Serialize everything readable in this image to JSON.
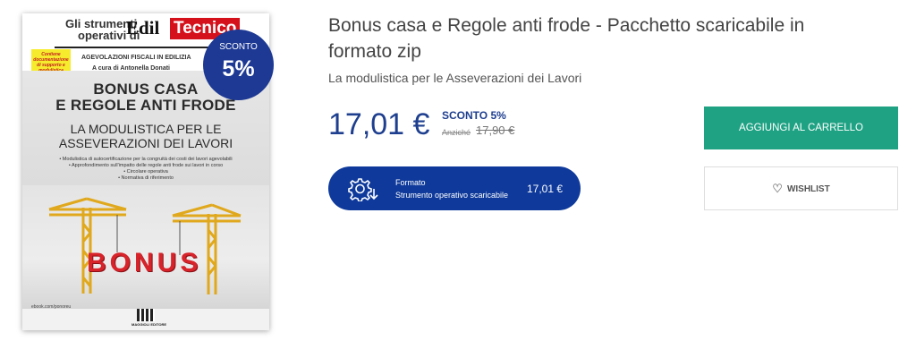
{
  "cover": {
    "series_line1": "Gli strumenti",
    "series_line2": "operativi di",
    "brand_edil": "Edil",
    "brand_tecnico": "Tecnico",
    "yellow_box_text": "Contiene documentazione di supporto e modulistica editabile e personalizzabile",
    "agevolazioni": "AGEVOLAZIONI FISCALI IN EDILIZIA",
    "curator": "A cura di Antonella Donati",
    "title_line1": "BONUS CASA",
    "title_line2": "E REGOLE ANTI FRODE",
    "subtitle_line1": "LA MODULISTICA PER LE",
    "subtitle_line2": "ASSEVERAZIONI DEI LAVORI",
    "bullets": [
      "• Modulistica di autocertificazione per la congruità dei costi dei lavori agevolabili",
      "• Approfondimento sull'impatto delle regole anti frode sui lavori in corso",
      "• Circolare operativa",
      "• Normativa di riferimento"
    ],
    "bonus_word": "BONUS",
    "ibook": "ebook.com/ponoreu",
    "publisher": "MAGGIOLI EDITORE"
  },
  "badge": {
    "label": "SCONTO",
    "value": "5%",
    "color": "#1d3994"
  },
  "product": {
    "title": "Bonus casa e Regole anti frode - Pacchetto scaricabile in formato zip",
    "subtitle": "La modulistica per le Asseverazioni dei Lavori",
    "price": "17,01 €",
    "discount_label": "SCONTO 5%",
    "before_label": "Anziché",
    "before_price": "17,90 €"
  },
  "format": {
    "icon": "gear-download-icon",
    "label": "Formato",
    "value": "Strumento operativo scaricabile",
    "price": "17,01 €",
    "color": "#0f3a9b"
  },
  "actions": {
    "cart_label": "AGGIUNGI AL CARRELLO",
    "cart_color": "#1ea283",
    "wishlist_label": "WISHLIST",
    "wishlist_icon": "heart-icon"
  }
}
